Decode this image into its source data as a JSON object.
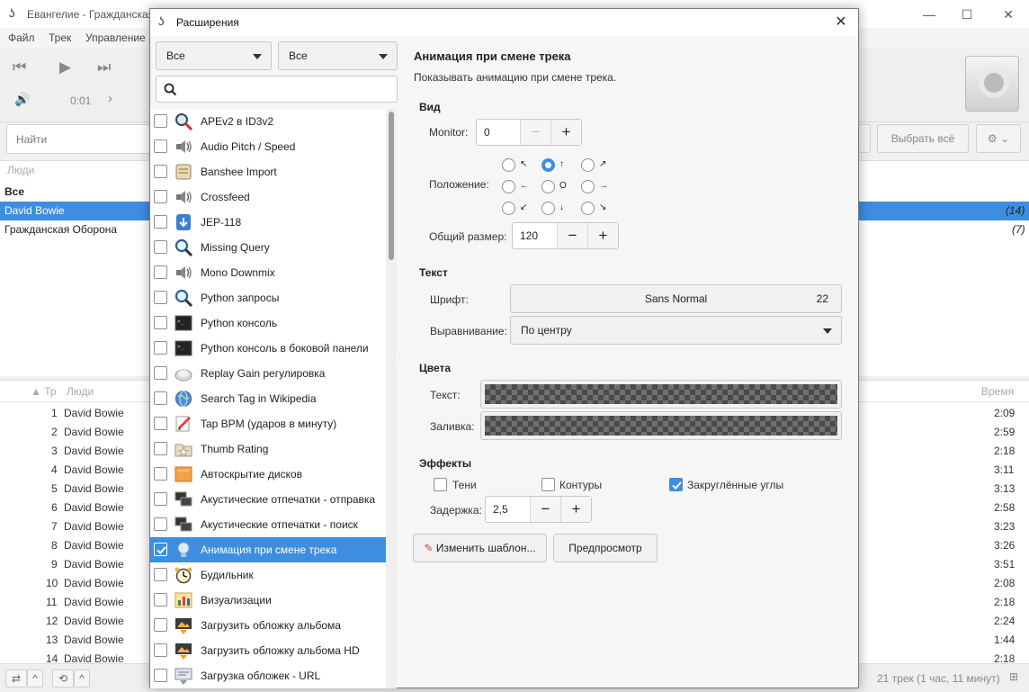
{
  "main_window": {
    "title": "Евангелие - Гражданская",
    "menu": [
      "Файл",
      "Трек",
      "Управление"
    ],
    "time": "0:01",
    "search_placeholder": "Найти",
    "select_all": "Выбрать всё",
    "people_header": "Люди",
    "people": [
      {
        "name": "Все",
        "count": ""
      },
      {
        "name": "David Bowie",
        "count": "(14)"
      },
      {
        "name": "Гражданская Оборона",
        "count": "(7)"
      }
    ],
    "tracks_header": {
      "track": "Тр",
      "artist": "Люди",
      "time": "Время"
    },
    "tracks": [
      {
        "n": "1",
        "artist": "David Bowie",
        "time": "2:09"
      },
      {
        "n": "2",
        "artist": "David Bowie",
        "time": "2:59"
      },
      {
        "n": "3",
        "artist": "David Bowie",
        "time": "2:18"
      },
      {
        "n": "4",
        "artist": "David Bowie",
        "time": "3:11"
      },
      {
        "n": "5",
        "artist": "David Bowie",
        "time": "3:13"
      },
      {
        "n": "6",
        "artist": "David Bowie",
        "time": "2:58"
      },
      {
        "n": "7",
        "artist": "David Bowie",
        "time": "3:23"
      },
      {
        "n": "8",
        "artist": "David Bowie",
        "time": "3:26"
      },
      {
        "n": "9",
        "artist": "David Bowie",
        "time": "3:51"
      },
      {
        "n": "10",
        "artist": "David Bowie",
        "time": "2:08"
      },
      {
        "n": "11",
        "artist": "David Bowie",
        "time": "2:18"
      },
      {
        "n": "12",
        "artist": "David Bowie",
        "time": "2:24"
      },
      {
        "n": "13",
        "artist": "David Bowie",
        "time": "1:44"
      },
      {
        "n": "14",
        "artist": "David Bowie",
        "time": "2:18"
      }
    ],
    "status": "21 трек (1 час, 11 минут)"
  },
  "dialog": {
    "title": "Расширения",
    "filter1": "Все",
    "filter2": "Все",
    "search_value": "",
    "extensions": [
      {
        "name": "APEv2 в ID3v2",
        "checked": false,
        "icon": "tag-search-icon"
      },
      {
        "name": "Audio Pitch / Speed",
        "checked": false,
        "icon": "speaker-icon"
      },
      {
        "name": "Banshee Import",
        "checked": false,
        "icon": "import-icon"
      },
      {
        "name": "Crossfeed",
        "checked": false,
        "icon": "speaker-icon"
      },
      {
        "name": "JEP-118",
        "checked": false,
        "icon": "broadcast-icon"
      },
      {
        "name": "Missing Query",
        "checked": false,
        "icon": "magnifier-icon"
      },
      {
        "name": "Mono Downmix",
        "checked": false,
        "icon": "speaker-icon"
      },
      {
        "name": "Python запросы",
        "checked": false,
        "icon": "magnifier-icon"
      },
      {
        "name": "Python консоль",
        "checked": false,
        "icon": "terminal-icon"
      },
      {
        "name": "Python консоль в боковой панели",
        "checked": false,
        "icon": "terminal-icon"
      },
      {
        "name": "Replay Gain регулировка",
        "checked": false,
        "icon": "gauge-icon"
      },
      {
        "name": "Search Tag in Wikipedia",
        "checked": false,
        "icon": "globe-icon"
      },
      {
        "name": "Tap BPM (ударов в минуту)",
        "checked": false,
        "icon": "pencil-icon"
      },
      {
        "name": "Thumb Rating",
        "checked": false,
        "icon": "folder-star-icon"
      },
      {
        "name": "Автоскрытие дисков",
        "checked": false,
        "icon": "orange-panel-icon"
      },
      {
        "name": "Акустические отпечатки - отправка",
        "checked": false,
        "icon": "monitors-icon"
      },
      {
        "name": "Акустические отпечатки - поиск",
        "checked": false,
        "icon": "monitors-icon"
      },
      {
        "name": "Анимация при смене трека",
        "checked": true,
        "icon": "lightbulb-icon"
      },
      {
        "name": "Будильник",
        "checked": false,
        "icon": "alarm-clock-icon"
      },
      {
        "name": "Визуализации",
        "checked": false,
        "icon": "visualizer-icon"
      },
      {
        "name": "Загрузить обложку альбома",
        "checked": false,
        "icon": "download-cover-icon"
      },
      {
        "name": "Загрузить обложку альбома HD",
        "checked": false,
        "icon": "download-cover-icon"
      },
      {
        "name": "Загрузка обложек - URL",
        "checked": false,
        "icon": "download-url-icon"
      }
    ],
    "config": {
      "title": "Анимация при смене трека",
      "description": "Показывать анимацию при смене трека.",
      "view_section": "Вид",
      "monitor_label": "Monitor:",
      "monitor_value": "0",
      "position_label": "Положение:",
      "position_glyphs": [
        "↖",
        "↑",
        "↗",
        "←",
        "O",
        "→",
        "↙",
        "↓",
        "↘"
      ],
      "position_selected": 1,
      "size_label": "Общий размер:",
      "size_value": "120",
      "text_section": "Текст",
      "font_label": "Шрифт:",
      "font_name": "Sans Normal",
      "font_size": "22",
      "align_label": "Выравнивание:",
      "align_value": "По центру",
      "colors_section": "Цвета",
      "text_color_label": "Текст:",
      "fill_color_label": "Заливка:",
      "effects_section": "Эффекты",
      "shadows_label": "Тени",
      "shadows_checked": false,
      "outlines_label": "Контуры",
      "outlines_checked": false,
      "rounded_label": "Закруглённые углы",
      "rounded_checked": true,
      "delay_label": "Задержка:",
      "delay_value": "2,5",
      "edit_template": "Изменить шаблон...",
      "preview": "Предпросмотр"
    }
  }
}
